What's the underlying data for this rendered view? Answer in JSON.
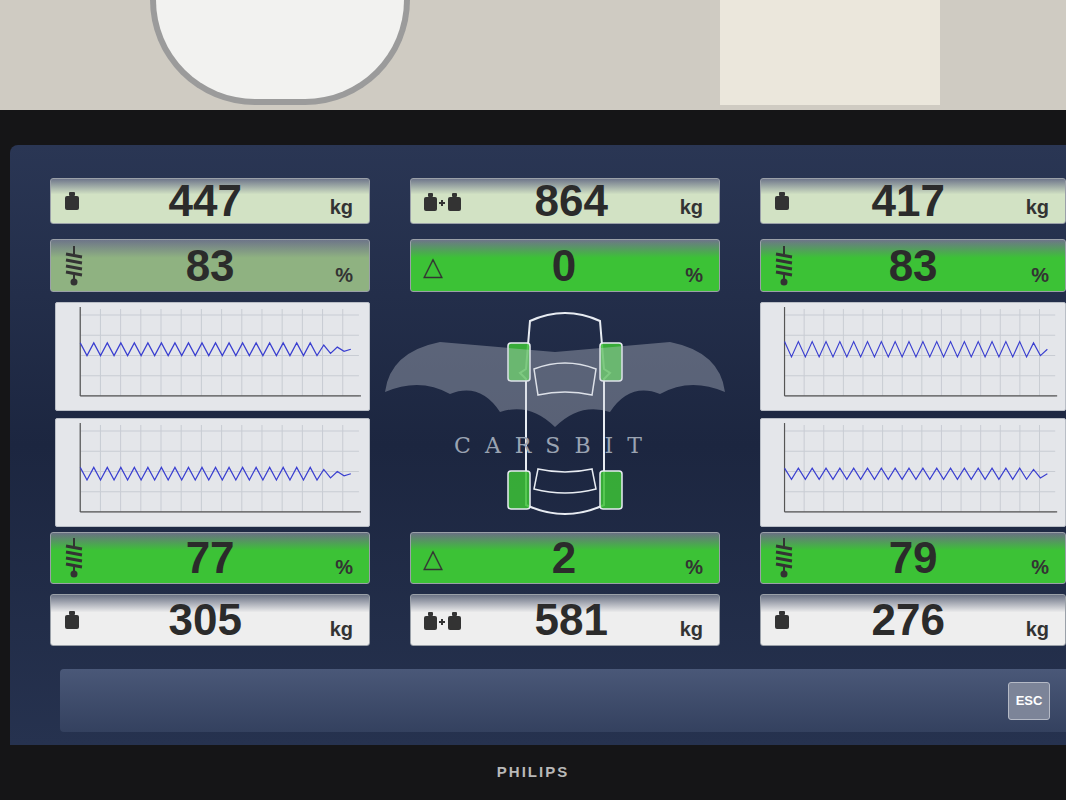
{
  "monitor": {
    "brand": "PHILIPS"
  },
  "front": {
    "weights": [
      {
        "value": "447",
        "unit": "kg",
        "kind": "single",
        "color": "#d2e2c4"
      },
      {
        "value": "864",
        "unit": "kg",
        "kind": "total",
        "color": "#d2e2c4"
      },
      {
        "value": "417",
        "unit": "kg",
        "kind": "single",
        "color": "#d2e2c4"
      }
    ],
    "damping": [
      {
        "value": "83",
        "unit": "%",
        "kind": "spring",
        "icon": "",
        "color": "#8fb281"
      },
      {
        "value": "0",
        "unit": "%",
        "kind": "difference",
        "icon": "△",
        "color": "#3cc236"
      },
      {
        "value": "83",
        "unit": "%",
        "kind": "spring",
        "icon": "",
        "color": "#3cc236"
      }
    ],
    "graphs": {
      "left": {
        "values": [
          2.5,
          -0.5,
          2.5,
          -0.5,
          2.5,
          -0.5,
          2.5,
          -0.5,
          2.5,
          -0.5,
          2.5,
          -0.5,
          2.5,
          -0.5,
          2.5,
          -0.5,
          2.5,
          -0.5,
          2.5,
          -0.5,
          2.5,
          -0.5,
          2.5,
          -0.5,
          2.5,
          -0.5,
          2.5,
          -0.5,
          2.5,
          -0.5,
          2.5,
          -0.5,
          2.5,
          -0.5,
          2.5,
          -0.5,
          2,
          0,
          1.5,
          0.5,
          1
        ]
      },
      "right": {
        "values": [
          2.8,
          -0.8,
          2.8,
          -0.8,
          2.8,
          -0.8,
          2.8,
          -0.8,
          2.8,
          -0.8,
          2.8,
          -0.8,
          2.8,
          -0.8,
          2.8,
          -0.8,
          2.8,
          -0.8,
          2.8,
          -0.8,
          2.8,
          -0.8,
          2.8,
          -0.8,
          2.8,
          -0.8,
          2.8,
          -0.8,
          2.8,
          -0.8,
          2.8,
          -0.8,
          2.8,
          -0.8,
          2.8,
          -0.8,
          2.5,
          -0.5,
          1
        ]
      }
    }
  },
  "rear": {
    "damping": [
      {
        "value": "77",
        "unit": "%",
        "kind": "spring",
        "icon": "",
        "color": "#3cc236"
      },
      {
        "value": "2",
        "unit": "%",
        "kind": "difference",
        "icon": "△",
        "color": "#3cc236"
      },
      {
        "value": "79",
        "unit": "%",
        "kind": "spring",
        "icon": "",
        "color": "#3cc236"
      }
    ],
    "weights": [
      {
        "value": "305",
        "unit": "kg",
        "kind": "single",
        "color": "#eeeeee"
      },
      {
        "value": "581",
        "unit": "kg",
        "kind": "total",
        "color": "#eeeeee"
      },
      {
        "value": "276",
        "unit": "kg",
        "kind": "single",
        "color": "#eeeeee"
      }
    ],
    "graphs": {
      "left": {
        "values": [
          0.5,
          -2.5,
          0.5,
          -2.5,
          0.5,
          -2.5,
          0.5,
          -2.5,
          0.5,
          -2.5,
          0.5,
          -2.5,
          0.5,
          -2.5,
          0.5,
          -2.5,
          0.5,
          -2.5,
          0.5,
          -2.5,
          0.5,
          -2.5,
          0.5,
          -2.5,
          0.5,
          -2.5,
          0.5,
          -2.5,
          0.5,
          -2.5,
          0.5,
          -2.5,
          0.5,
          -2.5,
          0.5,
          -2.5,
          0,
          -2,
          -0.5,
          -1.5,
          -1
        ]
      },
      "right": {
        "values": [
          0.3,
          -2.3,
          0.3,
          -2.3,
          0.3,
          -2.3,
          0.3,
          -2.3,
          0.3,
          -2.3,
          0.3,
          -2.3,
          0.3,
          -2.3,
          0.3,
          -2.3,
          0.3,
          -2.3,
          0.3,
          -2.3,
          0.3,
          -2.3,
          0.3,
          -2.3,
          0.3,
          -2.3,
          0.3,
          -2.3,
          0.3,
          -2.3,
          0.3,
          -2.3,
          0.3,
          -2.3,
          0.3,
          -2.3,
          0,
          -2,
          -1
        ]
      }
    }
  },
  "car": {
    "wheels": [
      {
        "position": "front-left",
        "highlighted": true
      },
      {
        "position": "front-right",
        "highlighted": true
      },
      {
        "position": "rear-left",
        "highlighted": true
      },
      {
        "position": "rear-right",
        "highlighted": true
      }
    ]
  },
  "watermark": {
    "text": "CARSBIT"
  },
  "bottom_bar": {
    "button": "ESC"
  }
}
